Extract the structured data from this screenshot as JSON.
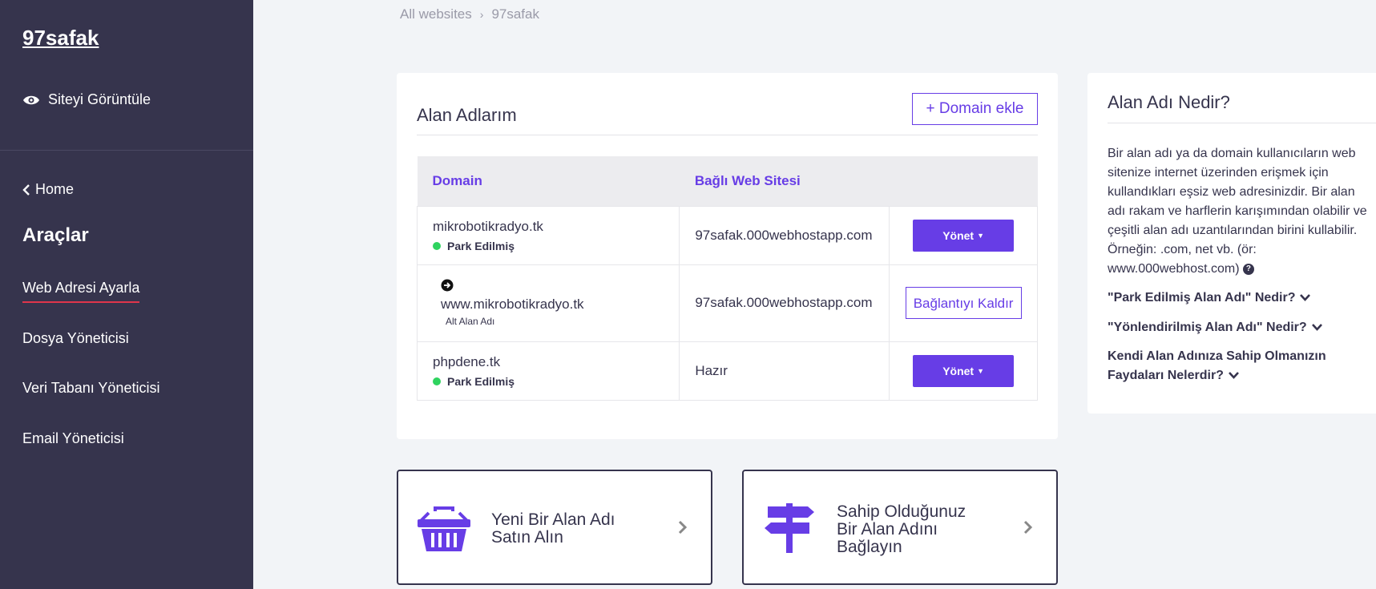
{
  "sidebar": {
    "site_title": "97safak",
    "view_site": "Siteyi Görüntüle",
    "home": "Home",
    "tools_title": "Araçlar",
    "items": [
      {
        "label": "Web Adresi Ayarla",
        "active": true
      },
      {
        "label": "Dosya Yöneticisi"
      },
      {
        "label": "Veri Tabanı Yöneticisi"
      },
      {
        "label": "Email Yöneticisi"
      }
    ]
  },
  "breadcrumb": [
    "All websites",
    "97safak"
  ],
  "domains_card": {
    "title": "Alan Adlarım",
    "add_button": "+ Domain ekle",
    "columns": [
      "Domain",
      "Bağlı Web Sitesi"
    ],
    "rows": [
      {
        "domain": "mikrobotikradyo.tk",
        "status": "Park Edilmiş",
        "site": "97safak.000webhostapp.com",
        "action": "Yönet"
      },
      {
        "domain": "www.mikrobotikradyo.tk",
        "status": "Alt Alan Adı",
        "site": "97safak.000webhostapp.com",
        "action": "Bağlantıyı Kaldır"
      },
      {
        "domain": "phpdene.tk",
        "status": "Park Edilmiş",
        "site": "Hazır",
        "action": "Yönet"
      }
    ]
  },
  "info_card": {
    "title": "Alan Adı Nedir?",
    "text": "Bir alan adı ya da domain kullanıcıların web sitenize internet üzerinden erişmek için kullandıkları eşsiz web adresinizdir. Bir alan adı rakam ve harflerin karışımından olabilir ve çeşitli alan adı uzantılarından birini kullabilir. Örneğin: .com, net vb. (ör: www.000webhost.com)",
    "faqs": [
      "\"Park Edilmiş Alan Adı\" Nedir?",
      "\"Yönlendirilmiş Alan Adı\" Nedir?",
      "Kendi Alan Adınıza Sahip Olmanızın Faydaları Nelerdir?"
    ]
  },
  "action_cards": [
    {
      "label_line1": "Yeni Bir Alan Adı",
      "label_line2": "Satın Alın",
      "icon": "basket-icon"
    },
    {
      "label_line1": "Sahip Olduğunuz",
      "label_line2": "Bir Alan Adını",
      "label_line3": "Bağlayın",
      "icon": "signpost-icon"
    }
  ],
  "colors": {
    "sidebar": "#36344d",
    "accent": "#673de6",
    "status_green": "#2fd35f",
    "active_underline": "#e0354b"
  }
}
